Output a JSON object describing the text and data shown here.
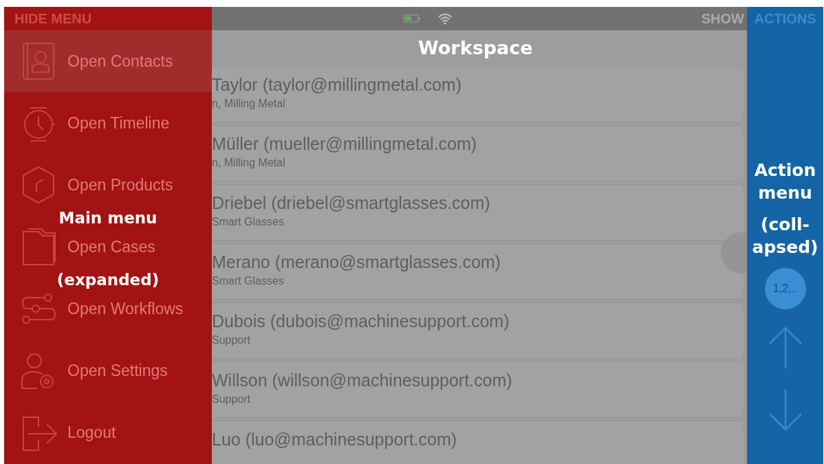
{
  "main_menu": {
    "toggle": "HIDE MENU",
    "items": [
      {
        "label": "Open Contacts",
        "selected": true
      },
      {
        "label": "Open Timeline",
        "selected": false
      },
      {
        "label": "Open Products",
        "selected": false
      },
      {
        "label": "Open Cases",
        "selected": false
      },
      {
        "label": "Open Workflows",
        "selected": false
      },
      {
        "label": "Open Settings",
        "selected": false
      },
      {
        "label": "Logout",
        "selected": false
      }
    ]
  },
  "status_bar": {
    "show": "SHOW"
  },
  "contacts": [
    {
      "name": "Taylor (taylor@millingmetal.com)",
      "company": "n, Milling Metal"
    },
    {
      "name": "Müller (mueller@millingmetal.com)",
      "company": "n, Milling Metal"
    },
    {
      "name": "Driebel (driebel@smartglasses.com)",
      "company": "Smart Glasses"
    },
    {
      "name": "Merano (merano@smartglasses.com)",
      "company": "Smart Glasses"
    },
    {
      "name": "Dubois (dubois@machinesupport.com)",
      "company": "Support"
    },
    {
      "name": "Willson (willson@machinesupport.com)",
      "company": "Support"
    },
    {
      "name": "Luo (luo@machinesupport.com)"
    }
  ],
  "action_menu": {
    "toggle": "ACTIONS",
    "page_badge": "1,2,.."
  },
  "annotations": {
    "main_menu": [
      "Main menu",
      "(expanded)"
    ],
    "workspace": "Workspace",
    "action_menu": [
      "Action menu",
      "(coll-",
      "apsed)"
    ]
  }
}
